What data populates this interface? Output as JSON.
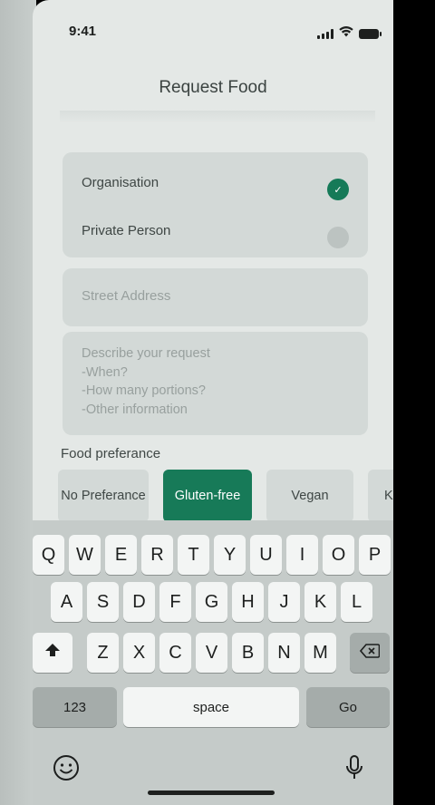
{
  "status_bar": {
    "time": "9:41"
  },
  "screen": {
    "title": "Request Food"
  },
  "requester_type": {
    "options": [
      {
        "label": "Organisation",
        "selected": true
      },
      {
        "label": "Private Person",
        "selected": false
      }
    ]
  },
  "address": {
    "placeholder": "Street Address"
  },
  "description": {
    "placeholder": "Describe your request\n-When?\n-How many portions?\n-Other information"
  },
  "food_preference": {
    "label": "Food preferance",
    "options": [
      {
        "label": "No Preferance",
        "selected": false
      },
      {
        "label": "Gluten-free",
        "selected": true
      },
      {
        "label": "Vegan",
        "selected": false
      },
      {
        "label": "K",
        "selected": false
      }
    ]
  },
  "keyboard": {
    "row1": [
      "Q",
      "W",
      "E",
      "R",
      "T",
      "Y",
      "U",
      "I",
      "O",
      "P"
    ],
    "row2": [
      "A",
      "S",
      "D",
      "F",
      "G",
      "H",
      "J",
      "K",
      "L"
    ],
    "row3": [
      "Z",
      "X",
      "C",
      "V",
      "B",
      "N",
      "M"
    ],
    "numbers_label": "123",
    "space_label": "space",
    "go_label": "Go"
  },
  "colors": {
    "accent": "#177a58",
    "background": "#e4e8e6",
    "card": "#d3d9d7",
    "keyboard": "#c5cbc9"
  }
}
